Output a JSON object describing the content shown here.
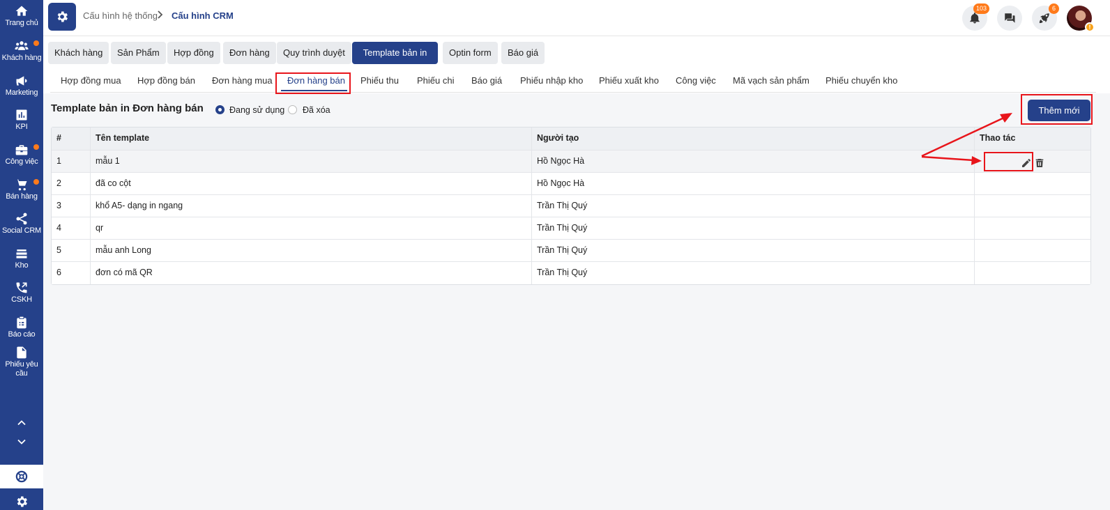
{
  "sidebar": {
    "items": [
      {
        "label": "Trang chủ",
        "icon": "home-icon",
        "dot": false
      },
      {
        "label": "Khách hàng",
        "icon": "users-icon",
        "dot": true
      },
      {
        "label": "Marketing",
        "icon": "megaphone-icon",
        "dot": false
      },
      {
        "label": "KPI",
        "icon": "chart-icon",
        "dot": false
      },
      {
        "label": "Công việc",
        "icon": "briefcase-icon",
        "dot": true
      },
      {
        "label": "Bán hàng",
        "icon": "cart-icon",
        "dot": true
      },
      {
        "label": "Social CRM",
        "icon": "share-icon",
        "dot": false
      },
      {
        "label": "Kho",
        "icon": "stack-icon",
        "dot": false
      },
      {
        "label": "CSKH",
        "icon": "phone-icon",
        "dot": false
      },
      {
        "label": "Báo cáo",
        "icon": "clipboard-icon",
        "dot": false
      },
      {
        "label": "Phiếu yêu cầu",
        "icon": "document-icon",
        "dot": false
      }
    ]
  },
  "header": {
    "breadcrumb": [
      "Cấu hình hệ thống",
      "Cấu hình CRM"
    ],
    "notifications_count": "103",
    "rocket_count": "6"
  },
  "module_tabs": [
    "Khách hàng",
    "Sản Phẩm",
    "Hợp đồng",
    "Đơn hàng",
    "Quy trình duyệt",
    "Template bản in",
    "Optin form",
    "Báo giá"
  ],
  "module_active": "Template bản in",
  "sub_tabs": [
    "Hợp đồng mua",
    "Hợp đồng bán",
    "Đơn hàng mua",
    "Đơn hàng bán",
    "Phiếu thu",
    "Phiếu chi",
    "Báo giá",
    "Phiếu nhập kho",
    "Phiếu xuất kho",
    "Công việc",
    "Mã vạch sản phẩm",
    "Phiếu chuyển kho"
  ],
  "sub_active": "Đơn hàng bán",
  "page": {
    "title": "Template bản in Đơn hàng bán",
    "filter_options": [
      "Đang sử dụng",
      "Đã xóa"
    ],
    "filter_selected": "Đang sử dụng",
    "add_button": "Thêm mới"
  },
  "table": {
    "columns": [
      "#",
      "Tên template",
      "Người tạo",
      "Thao tác"
    ],
    "rows": [
      {
        "idx": "1",
        "name": "mẫu 1",
        "creator": "Hồ Ngọc Hà"
      },
      {
        "idx": "2",
        "name": "đã co cột",
        "creator": "Hồ Ngọc Hà"
      },
      {
        "idx": "3",
        "name": "khổ A5- dạng in ngang",
        "creator": "Trần Thị Quý"
      },
      {
        "idx": "4",
        "name": "qr",
        "creator": "Trần Thị Quý"
      },
      {
        "idx": "5",
        "name": "mẫu anh Long",
        "creator": "Trần Thị Quý"
      },
      {
        "idx": "6",
        "name": "đơn có mã QR",
        "creator": "Trần Thị Quý"
      }
    ]
  },
  "colors": {
    "primary": "#25418a",
    "badge": "#ff7a1a",
    "annotation": "#e8151b"
  }
}
